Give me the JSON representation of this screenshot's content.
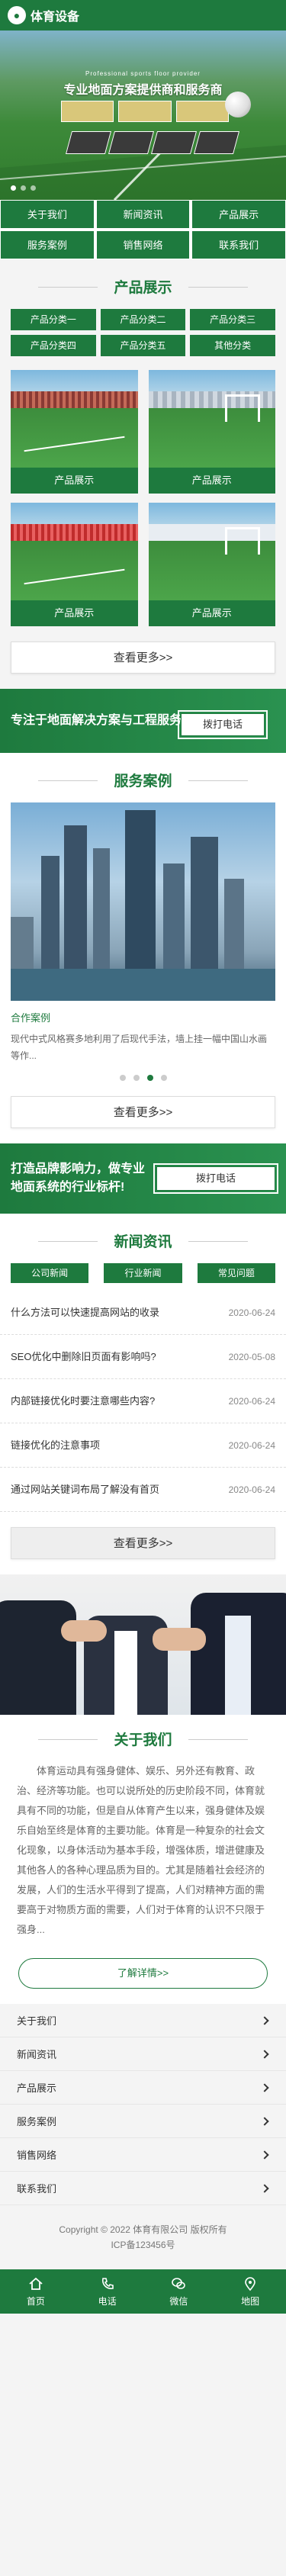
{
  "header": {
    "logo_text": "体育设备"
  },
  "banner": {
    "subtitle": "Professional sports floor provider",
    "title": "专业地面方案提供商和服务商"
  },
  "nav": [
    {
      "label": "关于我们"
    },
    {
      "label": "新闻资讯"
    },
    {
      "label": "产品展示"
    },
    {
      "label": "服务案例"
    },
    {
      "label": "销售网络"
    },
    {
      "label": "联系我们"
    }
  ],
  "products": {
    "title": "产品展示",
    "categories": [
      "产品分类一",
      "产品分类二",
      "产品分类三",
      "产品分类四",
      "产品分类五",
      "其他分类"
    ],
    "items": [
      {
        "label": "产品展示"
      },
      {
        "label": "产品展示"
      },
      {
        "label": "产品展示"
      },
      {
        "label": "产品展示"
      }
    ],
    "more_label": "查看更多>>"
  },
  "cta1": {
    "text": "专注于地面解决方案与工程服务",
    "button": "拨打电话"
  },
  "cases": {
    "title": "服务案例",
    "name": "合作案例",
    "desc": "现代中式风格赛多地利用了后现代手法，墙上挂一幅中国山水画等作...",
    "more_label": "查看更多>>"
  },
  "cta2": {
    "text": "打造品牌影响力，做专业地面系统的行业标杆!",
    "button": "拨打电话"
  },
  "news": {
    "title": "新闻资讯",
    "tabs": [
      "公司新闻",
      "行业新闻",
      "常见问题"
    ],
    "items": [
      {
        "title": "什么方法可以快速提高网站的收录",
        "date": "2020-06-24"
      },
      {
        "title": "SEO优化中删除旧页面有影响吗?",
        "date": "2020-05-08"
      },
      {
        "title": "内部链接优化时要注意哪些内容?",
        "date": "2020-06-24"
      },
      {
        "title": "链接优化的注意事项",
        "date": "2020-06-24"
      },
      {
        "title": "通过网站关键词布局了解没有首页",
        "date": "2020-06-24"
      }
    ],
    "more_label": "查看更多>>"
  },
  "about": {
    "title": "关于我们",
    "text": "体育运动具有强身健体、娱乐、另外还有教育、政治、经济等功能。也可以说所处的历史阶段不同，体育就具有不同的功能，但是自从体育产生以来，强身健体及娱乐自始至终是体育的主要功能。体育是一种复杂的社会文化现象，以身体活动为基本手段，增强体质，增进健康及其他各人的各种心理品质为目的。尤其是随着社会经济的发展，人们的生活水平得到了提高，人们对精神方面的需要高于对物质方面的需要，人们对于体育的认识不只限于强身...",
    "button": "了解详情>>"
  },
  "links": [
    "关于我们",
    "新闻资讯",
    "产品展示",
    "服务案例",
    "销售网络",
    "联系我们"
  ],
  "footer": {
    "copyright": "Copyright © 2022 体育有限公司 版权所有",
    "icp": "ICP备123456号"
  },
  "tabbar": [
    "首页",
    "电话",
    "微信",
    "地图"
  ]
}
